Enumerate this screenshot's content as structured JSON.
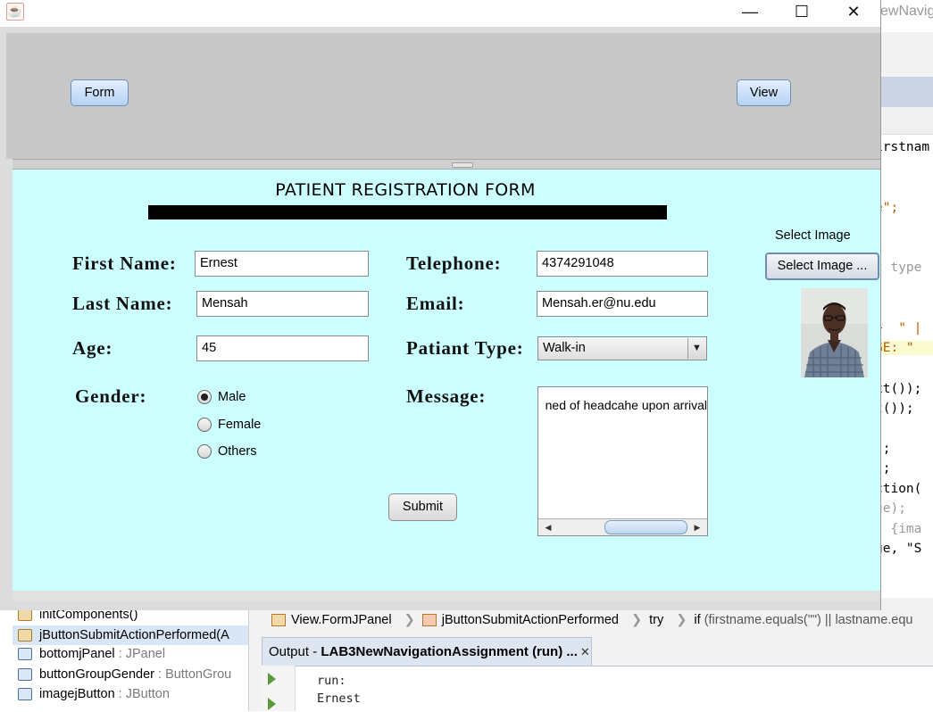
{
  "window": {
    "minimize_glyph": "—",
    "maximize_glyph": "☐",
    "close_glyph": "✕",
    "app_icon": "java-cup-icon"
  },
  "top_panel": {
    "form_button": "Form",
    "view_button": "View"
  },
  "form": {
    "title": "PATIENT REGISTRATION FORM",
    "first_name_label": "First Name:",
    "first_name_value": "Ernest",
    "last_name_label": "Last Name:",
    "last_name_value": "Mensah",
    "age_label": "Age:",
    "age_value": "45",
    "gender_label": "Gender:",
    "gender_options": [
      "Male",
      "Female",
      "Others"
    ],
    "gender_selected": "Male",
    "telephone_label": "Telephone:",
    "telephone_value": "4374291048",
    "email_label": "Email:",
    "email_value": "Mensah.er@nu.edu",
    "patient_type_label": "Patiant Type:",
    "patient_type_value": "Walk-in",
    "message_label": "Message:",
    "message_value": "ned of headcahe upon arrival",
    "submit_button": "Submit",
    "select_image_label": "Select Image",
    "select_image_button": "Select Image ..."
  },
  "ide": {
    "title_fragment": "ewNavigat",
    "code_lines": [
      {
        "text": "irstnam",
        "class": ""
      },
      {
        "text": "e\";",
        "class": "str"
      },
      {
        "text": "t type",
        "class": "grey"
      },
      {
        "text": "+  \" |",
        "class": "str"
      },
      {
        "text": "GE: \"",
        "class": "str"
      },
      {
        "text": "xt());",
        "class": ""
      },
      {
        "text": "t());",
        "class": ""
      },
      {
        "text": ");",
        "class": ""
      },
      {
        "text": ");",
        "class": ""
      },
      {
        "text": "ction(",
        "class": ""
      },
      {
        "text": "ge);",
        "class": "grey"
      },
      {
        "text": "] {ima",
        "class": "grey"
      },
      {
        "text": "ge, \"S",
        "class": ""
      }
    ],
    "navigator": [
      {
        "name": "initComponents()",
        "type": ""
      },
      {
        "name": "jButtonSubmitActionPerformed(A",
        "type": ""
      },
      {
        "name": "bottomjPanel",
        "type": " : JPanel"
      },
      {
        "name": "buttonGroupGender",
        "type": " : ButtonGrou"
      },
      {
        "name": "imagejButton",
        "type": " : JButton"
      }
    ],
    "breadcrumb": {
      "class_item": "View.FormJPanel",
      "method_item": "jButtonSubmitActionPerformed",
      "try_item": "try",
      "if_item": "if",
      "condition": "(firstname.equals(\"\") || lastname.equ"
    },
    "output_tab": {
      "prefix": "Output - ",
      "name": "LAB3NewNavigationAssignment (run) ...",
      "close_glyph": "✕"
    },
    "output_lines": [
      "run:",
      "Ernest"
    ]
  }
}
